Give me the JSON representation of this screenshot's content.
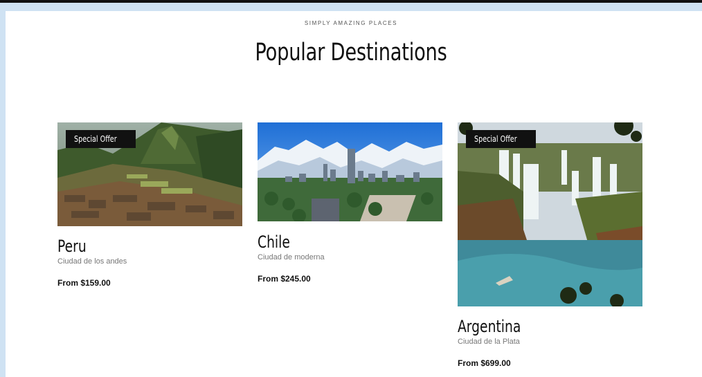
{
  "section": {
    "eyebrow": "SIMPLY AMAZING PLACES",
    "title": "Popular Destinations"
  },
  "cards": [
    {
      "badge": "Special Offer",
      "name": "Peru",
      "subtitle": "Ciudad de los andes",
      "price": "From $159.00"
    },
    {
      "badge": "",
      "name": "Chile",
      "subtitle": "Ciudad de moderna",
      "price": "From $245.00"
    },
    {
      "badge": "Special Offer",
      "name": "Argentina",
      "subtitle": "Ciudad de la Plata",
      "price": "From $699.00"
    }
  ],
  "colors": {
    "accent_frame": "#cfe2f3",
    "badge_bg": "#111111"
  }
}
